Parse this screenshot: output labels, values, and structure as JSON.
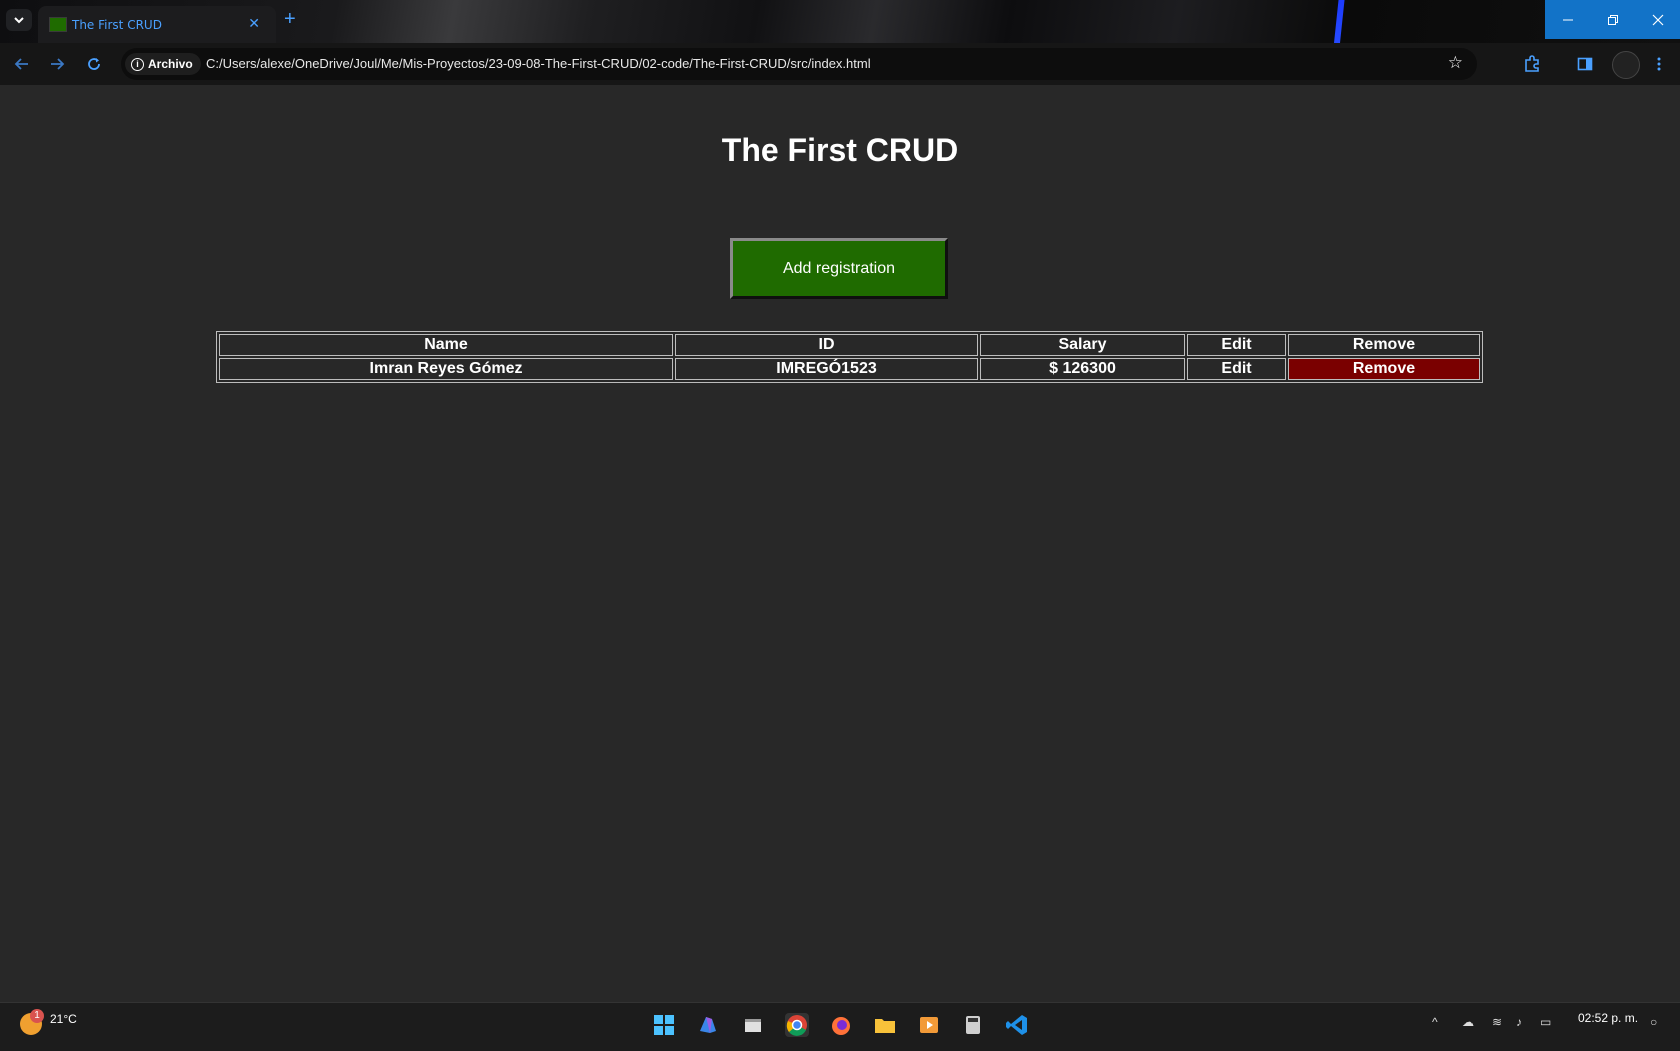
{
  "browser": {
    "tab_title": "The First CRUD",
    "tab_close": "✕",
    "new_tab": "+",
    "security_chip": "Archivo",
    "url": "C:/Users/alexe/OneDrive/Joul/Me/Mis-Proyectos/23-09-08-The-First-CRUD/02-code/The-First-CRUD/src/index.html"
  },
  "page": {
    "title": "The First CRUD",
    "add_button": "Add registration",
    "table": {
      "headers": [
        "Name",
        "ID",
        "Salary",
        "Edit",
        "Remove"
      ],
      "rows": [
        {
          "name": "Imran Reyes Gómez",
          "id": "IMREGÓ1523",
          "salary": "$ 126300",
          "edit": "Edit",
          "remove": "Remove"
        }
      ]
    }
  },
  "taskbar": {
    "weather_badge": "1",
    "temperature": "21°C",
    "clock": "02:52 p. m."
  },
  "colors": {
    "page_bg": "#282828",
    "add_button_bg": "#1f6b00",
    "remove_bg": "#7a0000",
    "accent": "#4aa0ff",
    "window_controls": "#1273c8"
  }
}
